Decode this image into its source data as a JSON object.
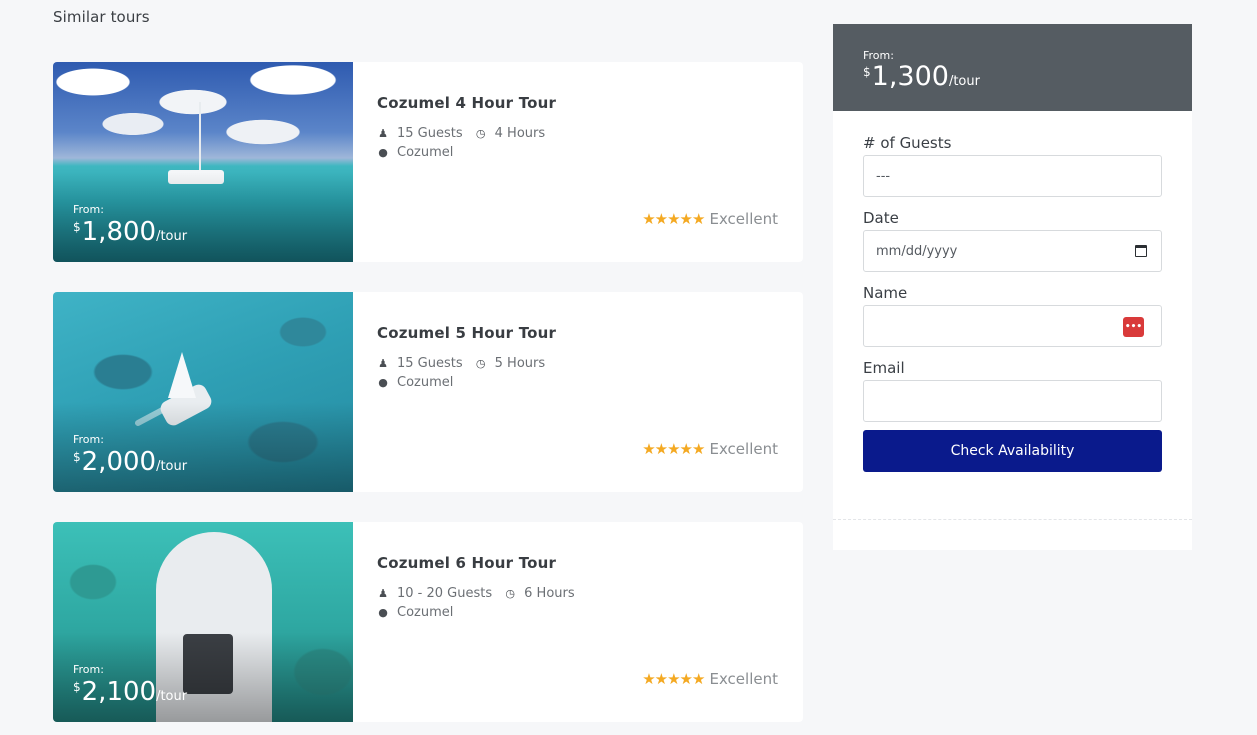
{
  "section": {
    "title": "Similar tours"
  },
  "tours": [
    {
      "from_label": "From:",
      "currency": "$",
      "price": "1,800",
      "per": "/tour",
      "title": "Cozumel 4 Hour Tour",
      "guests": "15 Guests",
      "duration": "4 Hours",
      "location": "Cozumel",
      "stars": "★★★★★",
      "rating_label": "Excellent"
    },
    {
      "from_label": "From:",
      "currency": "$",
      "price": "2,000",
      "per": "/tour",
      "title": "Cozumel 5 Hour Tour",
      "guests": "15 Guests",
      "duration": "5 Hours",
      "location": "Cozumel",
      "stars": "★★★★★",
      "rating_label": "Excellent"
    },
    {
      "from_label": "From:",
      "currency": "$",
      "price": "2,100",
      "per": "/tour",
      "title": "Cozumel 6 Hour Tour",
      "guests": "10 - 20 Guests",
      "duration": "6 Hours",
      "location": "Cozumel",
      "stars": "★★★★★",
      "rating_label": "Excellent"
    }
  ],
  "booking": {
    "from_label": "From:",
    "currency": "$",
    "price": "1,300",
    "per": "/tour",
    "guests_label": "# of Guests",
    "guests_value": "---",
    "date_label": "Date",
    "date_placeholder": "mm/dd/yyyy",
    "name_label": "Name",
    "name_value": "",
    "email_label": "Email",
    "email_value": "",
    "button_label": "Check Availability"
  },
  "icons": {
    "guests": "user-icon",
    "duration": "clock-icon",
    "location": "globe-icon",
    "rating": "star-icon",
    "date": "calendar-icon",
    "password_manager": "password-manager-icon"
  },
  "colors": {
    "booking_header": "#555c62",
    "button": "#0a1a8c",
    "stars": "#f4a922",
    "page_bg": "#f6f7f9"
  }
}
